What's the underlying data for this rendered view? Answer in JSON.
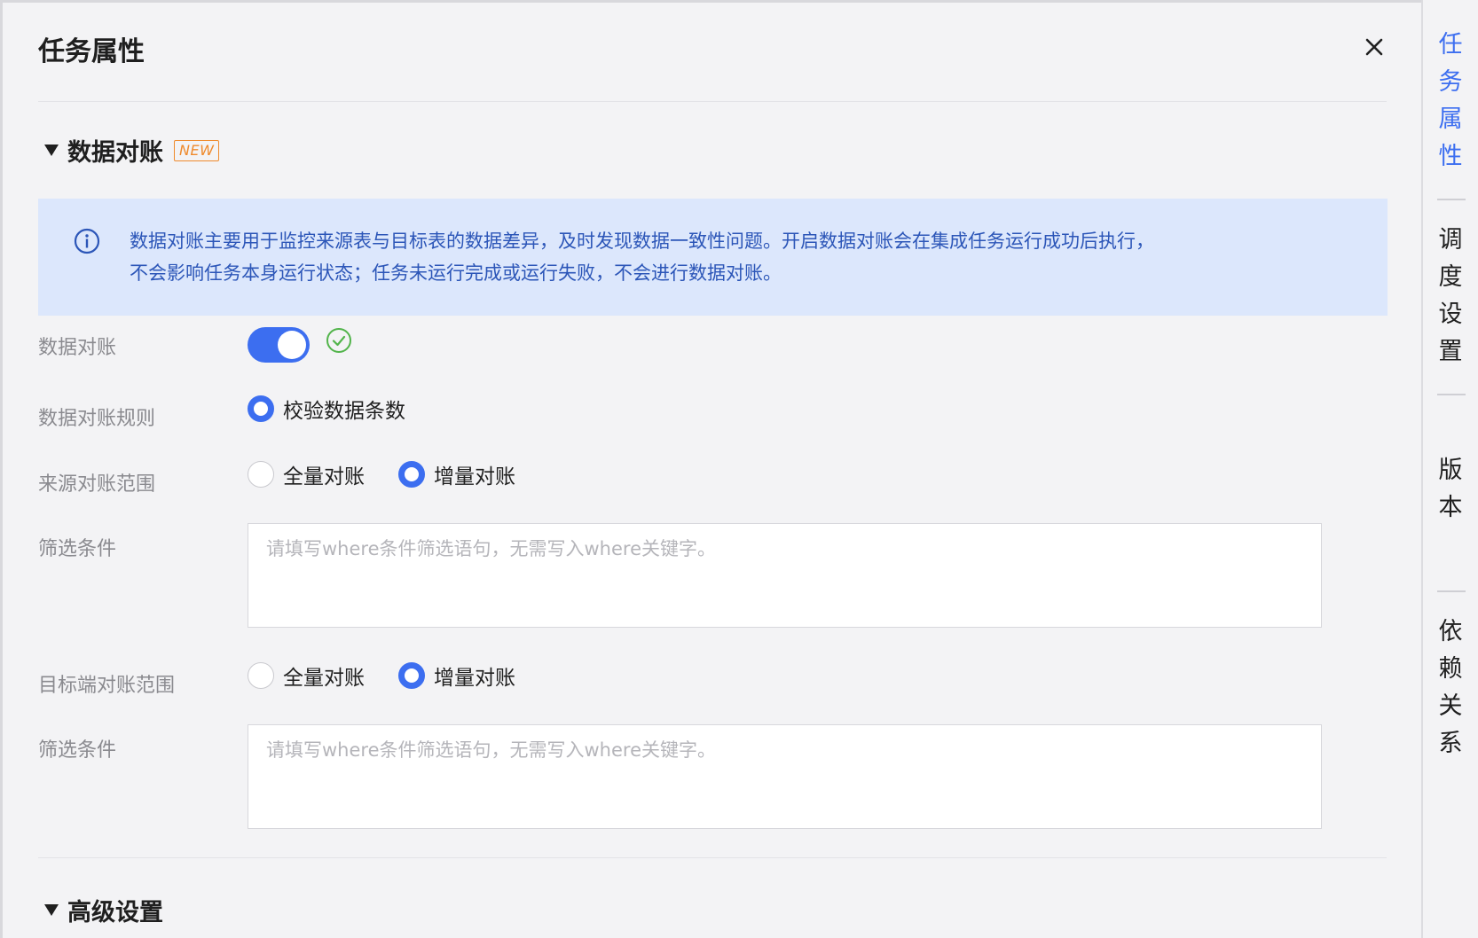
{
  "header": {
    "title": "任务属性"
  },
  "section_reconcile": {
    "title": "数据对账",
    "new_tag": "NEW",
    "info_line1": "数据对账主要用于监控来源表与目标表的数据差异，及时发现数据一致性问题。开启数据对账会在集成任务运行成功后执行，",
    "info_line2": "不会影响任务本身运行状态；任务未运行完成或运行失败，不会进行数据对账。",
    "toggle_label": "数据对账",
    "toggle_on": true,
    "rule_label": "数据对账规则",
    "rule_option": "校验数据条数",
    "source_scope_label": "来源对账范围",
    "source_options": [
      "全量对账",
      "增量对账"
    ],
    "source_selected": "增量对账",
    "source_filter_label": "筛选条件",
    "source_filter_placeholder": "请填写where条件筛选语句，无需写入where关键字。",
    "target_scope_label": "目标端对账范围",
    "target_options": [
      "全量对账",
      "增量对账"
    ],
    "target_selected": "增量对账",
    "target_filter_label": "筛选条件",
    "target_filter_placeholder": "请填写where条件筛选语句，无需写入where关键字。"
  },
  "section_advanced": {
    "title": "高级设置"
  },
  "right_tabs": [
    {
      "label": "任务属性",
      "chars": [
        "任",
        "务",
        "属",
        "性"
      ],
      "active": true
    },
    {
      "label": "调度设置",
      "chars": [
        "调",
        "度",
        "设",
        "置"
      ],
      "active": false
    },
    {
      "label": "版本",
      "chars": [
        "版",
        "本"
      ],
      "active": false
    },
    {
      "label": "依赖关系",
      "chars": [
        "依",
        "赖",
        "关",
        "系"
      ],
      "active": false
    }
  ],
  "colors": {
    "accent": "#3c6ef0",
    "info_bg": "#dce7fc",
    "new_tag": "#ef8a2c",
    "success": "#52b44b"
  }
}
